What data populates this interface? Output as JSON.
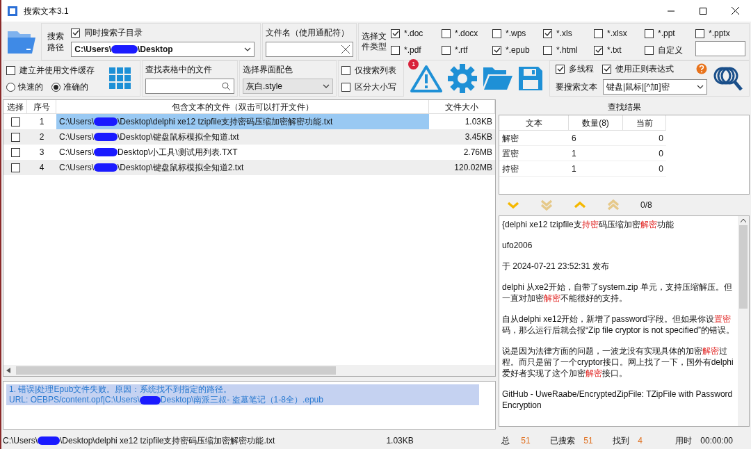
{
  "window": {
    "title": "搜索文本3.1"
  },
  "search_path": {
    "label": "搜索路径",
    "subdirs": {
      "label": "同时搜索子目录",
      "checked": true
    },
    "value_start": "C:\\Users\\",
    "value_end": "\\Desktop"
  },
  "file_name": {
    "label": "文件名（使用通配符）"
  },
  "file_types": {
    "label": "选择文件类型",
    "items": [
      {
        "label": "*.doc",
        "checked": true
      },
      {
        "label": "*.docx",
        "checked": false
      },
      {
        "label": "*.wps",
        "checked": false
      },
      {
        "label": "*.xls",
        "checked": true
      },
      {
        "label": "*.xlsx",
        "checked": false
      },
      {
        "label": "*.ppt",
        "checked": false
      },
      {
        "label": "*.pptx",
        "checked": false
      },
      {
        "label": "*.pdf",
        "checked": false
      },
      {
        "label": "*.rtf",
        "checked": false
      },
      {
        "label": "*.epub",
        "checked": true
      },
      {
        "label": "*.html",
        "checked": false
      },
      {
        "label": "*.txt",
        "checked": true
      },
      {
        "label": "自定义",
        "checked": false
      }
    ]
  },
  "cache": {
    "label": "建立并使用文件缓存",
    "checked": false
  },
  "modes": [
    {
      "label": "快速的",
      "selected": false
    },
    {
      "label": "准确的",
      "selected": true
    }
  ],
  "table_search": {
    "label": "查找表格中的文件"
  },
  "theme": {
    "label": "选择界面配色",
    "value": "灰白.style"
  },
  "options": [
    {
      "label": "仅搜索列表",
      "checked": false
    },
    {
      "label": "区分大小写",
      "checked": false
    }
  ],
  "alert_badge": "1",
  "multithread": {
    "label": "多线程",
    "checked": true
  },
  "regex": {
    "label": "使用正则表达式",
    "checked": true
  },
  "search_text": {
    "label": "要搜索文本",
    "value": "键盘|鼠标|[^加]密"
  },
  "table": {
    "columns": [
      "选择",
      "序号",
      "包含文本的文件（双击可以打开文件）",
      "文件大小"
    ],
    "rows": [
      {
        "checked": false,
        "index": "1",
        "path_start": "C:\\Users\\",
        "path_end": "\\Desktop\\delphi xe12 tzipfile支持密码压缩加密解密功能.txt",
        "size": "1.03KB",
        "selected": true
      },
      {
        "checked": false,
        "index": "2",
        "path_start": "C:\\Users\\",
        "path_end": "\\Desktop\\键盘鼠标模拟全知道.txt",
        "size": "3.45KB",
        "selected": false
      },
      {
        "checked": false,
        "index": "3",
        "path_start": "C:\\Users\\",
        "path_end": "Desktop\\小工具\\测试用列表.TXT",
        "size": "2.76MB",
        "selected": false
      },
      {
        "checked": false,
        "index": "4",
        "path_start": "C:\\Users\\",
        "path_end": "\\Desktop\\键盘鼠标模拟全知道2.txt",
        "size": "120.02MB",
        "selected": false
      }
    ]
  },
  "results": {
    "title": "查找结果",
    "columns": [
      "文本",
      "数量(8)",
      "当前"
    ],
    "rows": [
      {
        "text": "解密",
        "count": "6",
        "current": "0"
      },
      {
        "text": "置密",
        "count": "1",
        "current": "0"
      },
      {
        "text": "持密",
        "count": "1",
        "current": "0"
      }
    ],
    "position": "0/8"
  },
  "preview": [
    [
      {
        "text": "{delphi xe12 tzipfile支",
        "highlight": false
      },
      {
        "text": "持密",
        "highlight": true
      },
      {
        "text": "码压缩加密",
        "highlight": false
      },
      {
        "text": "解密",
        "highlight": true
      },
      {
        "text": "功能",
        "highlight": false
      }
    ],
    [
      {
        "text": "ufo2006",
        "highlight": false
      }
    ],
    [
      {
        "text": "于 2024-07-21 23:52:31 发布",
        "highlight": false
      }
    ],
    [
      {
        "text": "delphi 从xe2开始，自带了system.zip 单元，支持压缩解压。但一直对加密",
        "highlight": false
      },
      {
        "text": "解密",
        "highlight": true
      },
      {
        "text": "不能很好的支持。",
        "highlight": false
      }
    ],
    [
      {
        "text": "自从delphi xe12开始，新增了password字段。但如果你设",
        "highlight": false
      },
      {
        "text": "置密",
        "highlight": true
      },
      {
        "text": "码，那么运行后就会报“Zip file cryptor is not specified”的错误。",
        "highlight": false
      }
    ],
    [
      {
        "text": "说是因为法律方面的问题，一波龙没有实现具体的加密",
        "highlight": false
      },
      {
        "text": "解密",
        "highlight": true
      },
      {
        "text": "过程。而只是留了一个cryptor接口。网上找了一下，国外有delphi爱好者实现了这个加密",
        "highlight": false
      },
      {
        "text": "解密",
        "highlight": true
      },
      {
        "text": "接口。",
        "highlight": false
      }
    ],
    [
      {
        "text": "GitHub - UweRaabe/EncryptedZipFile: TZipFile with Password Encryption",
        "highlight": false
      }
    ]
  ],
  "log": {
    "line1": "1. 错误|处理Epub文件失败。原因：系统找不到指定的路径。",
    "line2_start": "URL: OEBPS/content.opf|C:\\Users\\",
    "line2_end": "Desktop\\南派三叔- 盗墓笔记（1-8全）.epub"
  },
  "status_bar": {
    "path_start": "C:\\Users\\",
    "path_end": "\\Desktop\\delphi xe12 tzipfile支持密码压缩加密解密功能.txt",
    "size": "1.03KB",
    "total_label": "总",
    "total": "51",
    "searched_label": "已搜索",
    "searched": "51",
    "found_label": "找到",
    "found": "4",
    "time_label": "用时",
    "time": "00:00:00"
  }
}
